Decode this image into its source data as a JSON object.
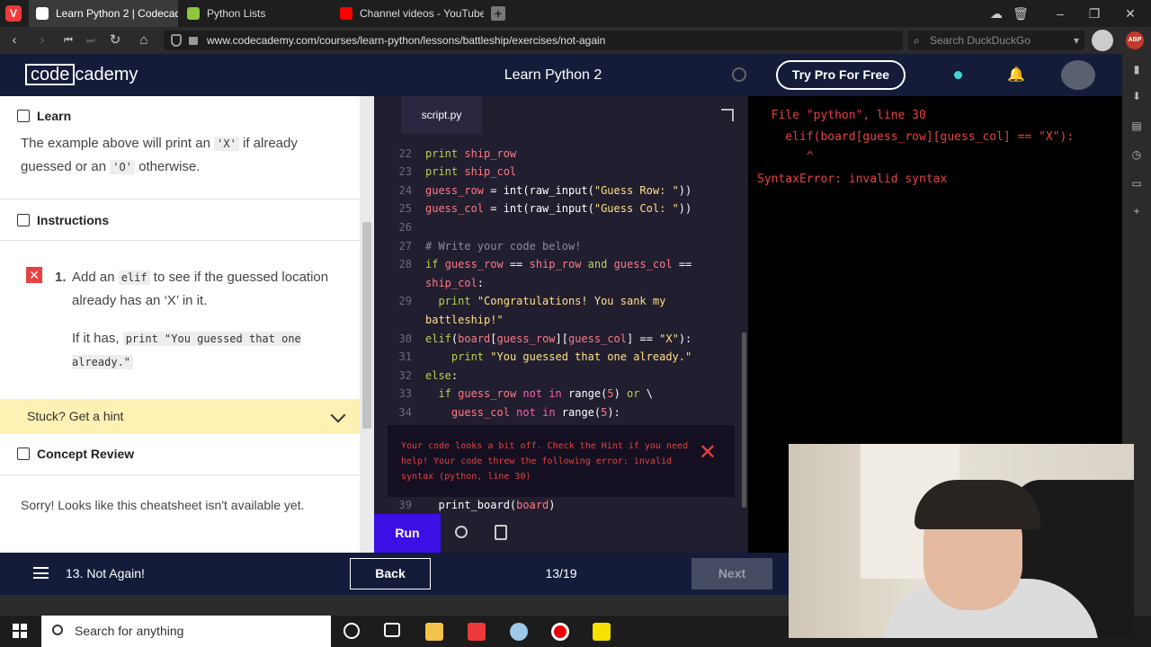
{
  "browser": {
    "tabs": [
      {
        "title": "Learn Python 2 | Codecademy",
        "favicon_color": "#ffffff",
        "active": true
      },
      {
        "title": "Python Lists",
        "favicon_color": "#8dc63f",
        "active": false
      },
      {
        "title": "Channel videos - YouTube Studio",
        "favicon_color": "#ff0000",
        "active": false
      }
    ],
    "url": "www.codecademy.com/courses/learn-python/lessons/battleship/exercises/not-again",
    "search_placeholder": "Search DuckDuckGo",
    "abp": "ABP"
  },
  "header": {
    "logo_part1": "code",
    "logo_part2": "cademy",
    "course_title": "Learn Python 2",
    "try_pro": "Try Pro For Free"
  },
  "learn": {
    "heading": "Learn",
    "text_before": "The example above will print an ",
    "code1": "'X'",
    "text_mid": " if already guessed or an ",
    "code2": "'O'",
    "text_after": " otherwise."
  },
  "instructions": {
    "heading": "Instructions",
    "step_number": "1.",
    "step_text_before": "Add an ",
    "step_code": "elif",
    "step_text_after": " to see if the guessed location already has an ‘X’ in it.",
    "followup_before": "If it has, ",
    "followup_code": "print \"You guessed that one already.\""
  },
  "hint": {
    "label": "Stuck? Get a hint"
  },
  "concept_review": {
    "heading": "Concept Review",
    "text": "Sorry! Looks like this cheatsheet isn't available yet."
  },
  "editor": {
    "file_tab": "script.py",
    "line_numbers": [
      "22",
      "23",
      "24",
      "25",
      "26",
      "27",
      "28",
      "29",
      "30",
      "31",
      "32",
      "33",
      "34",
      "39"
    ],
    "error_message": "Your code looks a bit off. Check the Hint if you need help! Your code threw the following error: invalid syntax (python, line 30)",
    "run_label": "Run"
  },
  "output": {
    "line1": "  File \"python\", line 30",
    "line2": "    elif(board[guess_row][guess_col] == \"X\"):",
    "line3": "       ^",
    "line4": "SyntaxError: invalid syntax"
  },
  "footer": {
    "lesson": "13. Not Again!",
    "back": "Back",
    "progress": "13/19",
    "next": "Next"
  },
  "taskbar": {
    "search_placeholder": "Search for anything"
  },
  "colors": {
    "header_bg": "#141c3a",
    "run_button": "#3a10e5",
    "hint_bg": "#fff0b3",
    "error": "#e84141"
  }
}
